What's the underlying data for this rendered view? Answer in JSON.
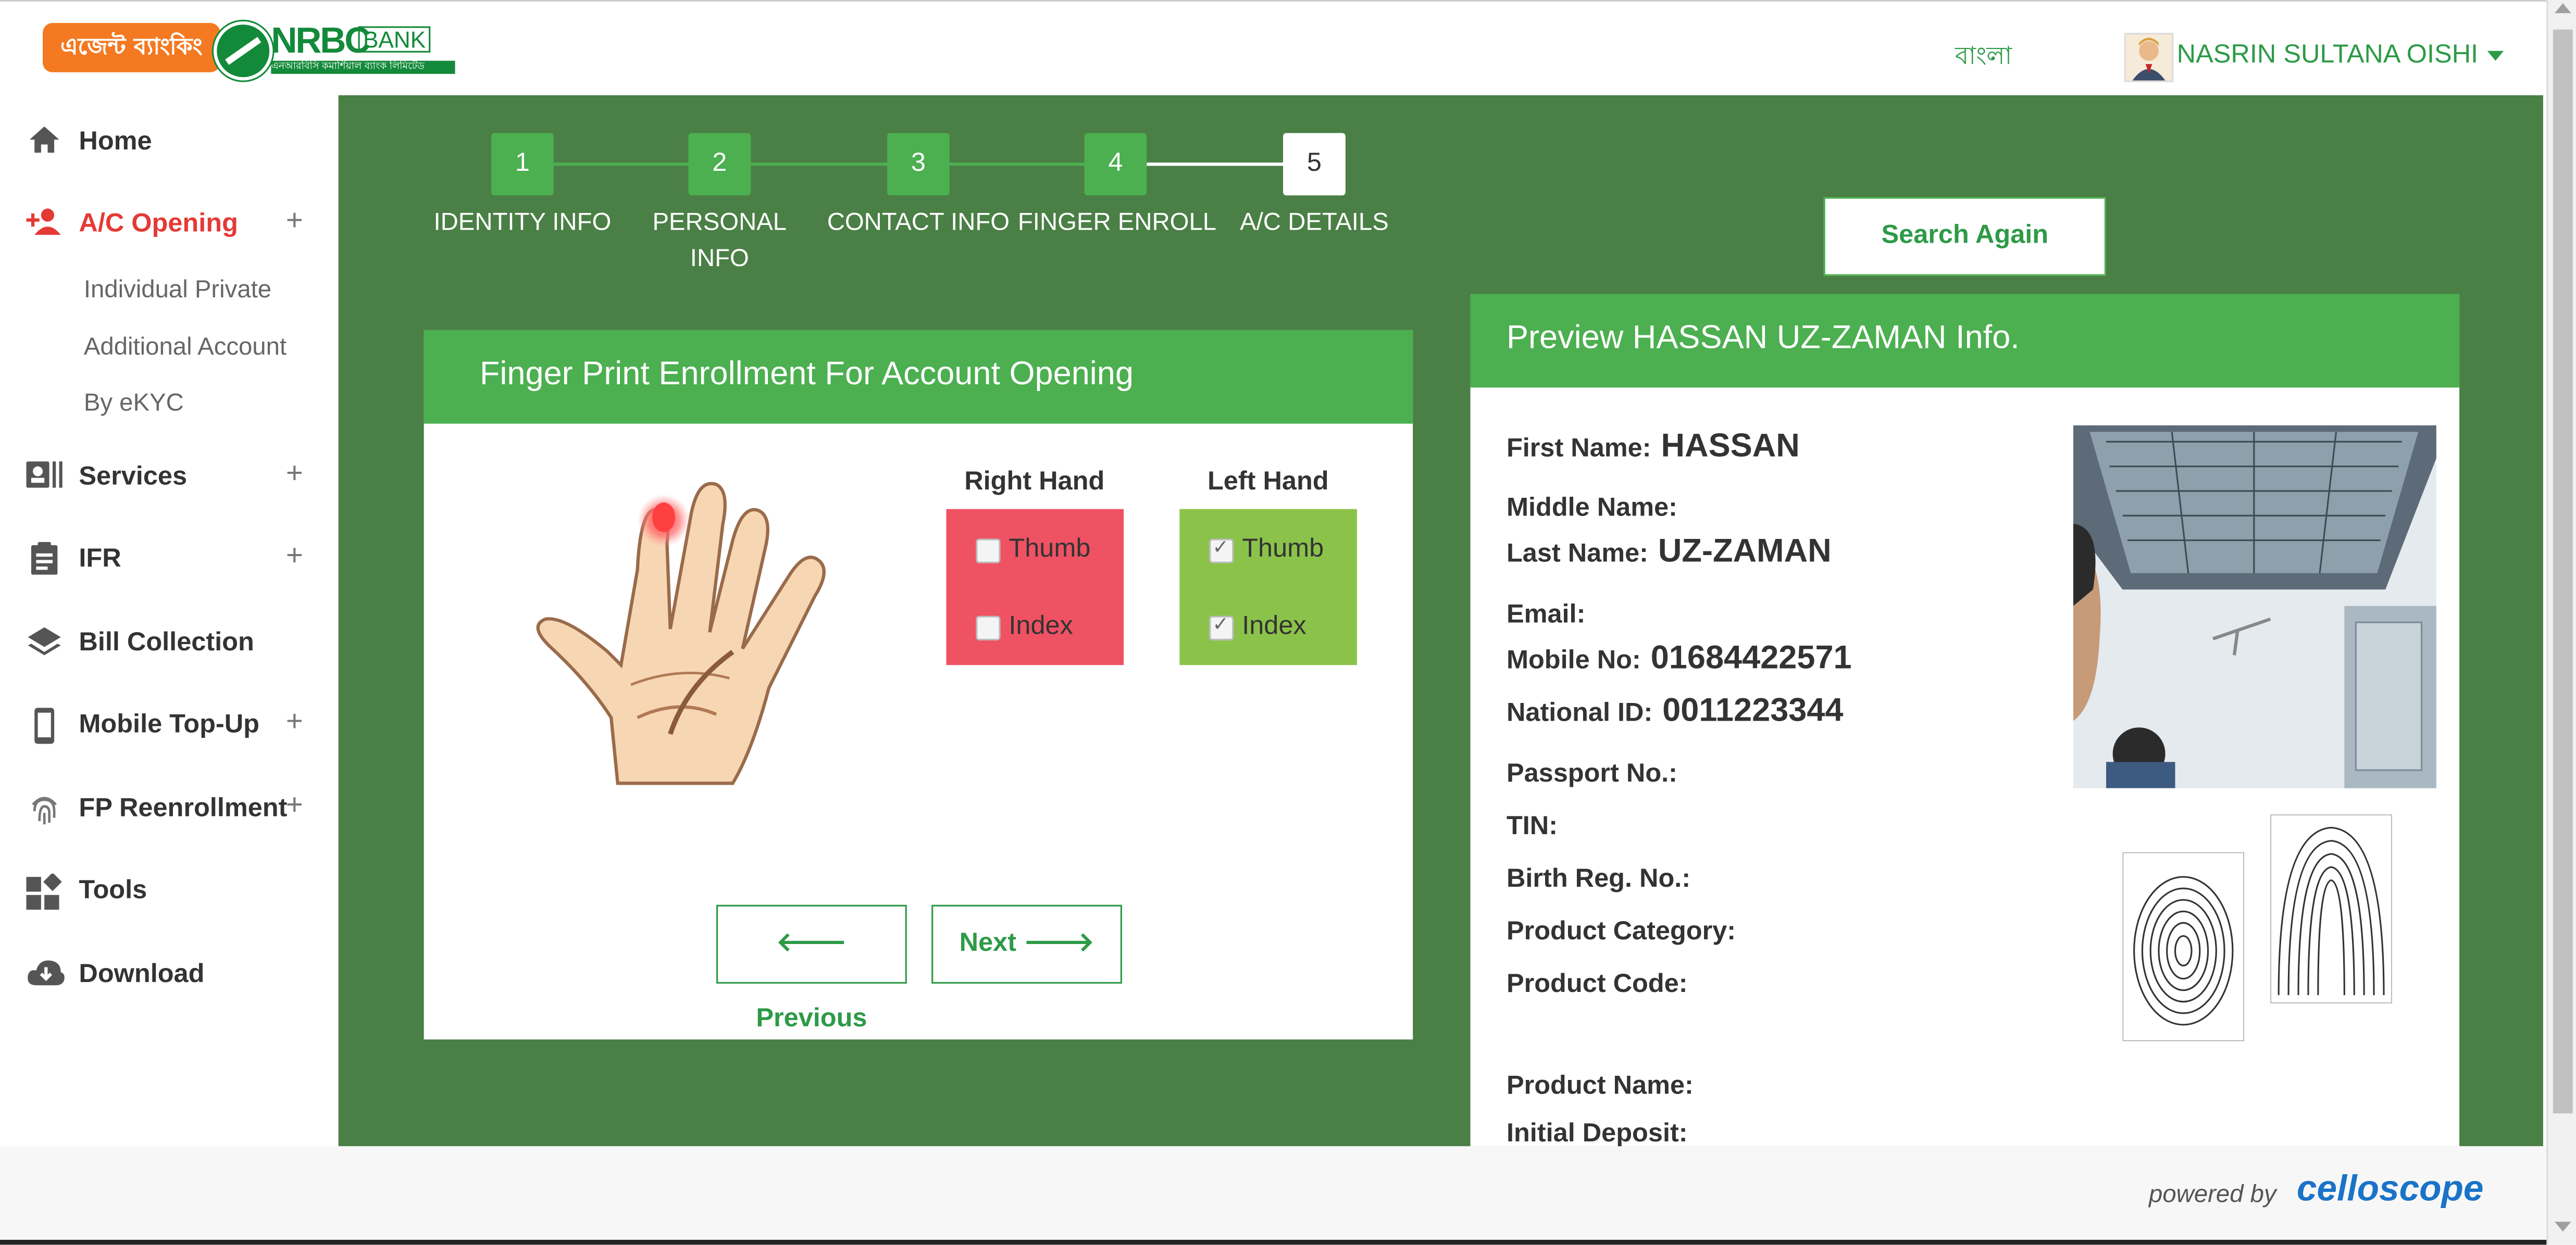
{
  "header": {
    "logo_agent_text": "এজেন্ট ব্যাংকিং",
    "logo_bank_text": "NRBC",
    "logo_bank_suffix": "BANK",
    "logo_subtitle": "এনআরবিসি কমার্শিয়াল ব্যাংক লিমিটেড",
    "language_link": "বাংলা",
    "user_name": "NASRIN SULTANA OISHI"
  },
  "sidebar": {
    "items": [
      {
        "label": "Home",
        "icon": "home-icon",
        "expandable": false
      },
      {
        "label": "A/C Opening",
        "icon": "add-user-icon",
        "expandable": true,
        "active": true,
        "children": [
          "Individual Private",
          "Additional Account",
          "By eKYC"
        ]
      },
      {
        "label": "Services",
        "icon": "id-card-icon",
        "expandable": true
      },
      {
        "label": "IFR",
        "icon": "clipboard-icon",
        "expandable": true
      },
      {
        "label": "Bill Collection",
        "icon": "layers-icon",
        "expandable": false
      },
      {
        "label": "Mobile Top-Up",
        "icon": "mobile-icon",
        "expandable": true
      },
      {
        "label": "FP Reenrollment",
        "icon": "fingerprint-icon",
        "expandable": true
      },
      {
        "label": "Tools",
        "icon": "widgets-icon",
        "expandable": false
      },
      {
        "label": "Download",
        "icon": "cloud-download-icon",
        "expandable": false
      }
    ],
    "plus_symbol": "+"
  },
  "stepper": {
    "steps": [
      {
        "number": "1",
        "label": "IDENTITY INFO",
        "done": true
      },
      {
        "number": "2",
        "label": "PERSONAL INFO",
        "done": true
      },
      {
        "number": "3",
        "label": "CONTACT INFO",
        "done": true
      },
      {
        "number": "4",
        "label": "FINGER ENROLL",
        "done": true
      },
      {
        "number": "5",
        "label": "A/C DETAILS",
        "done": false,
        "current": true
      }
    ]
  },
  "search_again_label": "Search Again",
  "finger_card": {
    "title": "Finger Print Enrollment For Account Opening",
    "right_hand": {
      "title": "Right Hand",
      "color": "#ef5263",
      "options": [
        {
          "label": "Thumb",
          "checked": false
        },
        {
          "label": "Index",
          "checked": false
        }
      ]
    },
    "left_hand": {
      "title": "Left Hand",
      "color": "#8bc34a",
      "options": [
        {
          "label": "Thumb",
          "checked": true
        },
        {
          "label": "Index",
          "checked": true
        }
      ]
    },
    "previous_label": "Previous",
    "next_label": "Next"
  },
  "preview": {
    "title": "Preview HASSAN UZ-ZAMAN Info.",
    "fields": [
      {
        "key": "First Name:",
        "value": "HASSAN"
      },
      {
        "key": "Middle Name:",
        "value": ""
      },
      {
        "key": "Last Name:",
        "value": "UZ-ZAMAN"
      },
      {
        "key": "Email:",
        "value": ""
      },
      {
        "key": "Mobile No:",
        "value": "01684422571"
      },
      {
        "key": "National ID:",
        "value": "0011223344"
      },
      {
        "key": "Passport No.:",
        "value": ""
      },
      {
        "key": "TIN:",
        "value": ""
      },
      {
        "key": "Birth Reg. No.:",
        "value": ""
      },
      {
        "key": "Product Category:",
        "value": ""
      },
      {
        "key": "Product Code:",
        "value": ""
      },
      {
        "key": "Product Name:",
        "value": ""
      },
      {
        "key": "Initial Deposit:",
        "value": ""
      }
    ]
  },
  "footer": {
    "powered_by": "powered by",
    "brand": "celloscope"
  },
  "colors": {
    "main_bg": "#4a7f45",
    "accent_green": "#4caf50",
    "link_green": "#2e9a47",
    "active_red": "#e53935"
  }
}
